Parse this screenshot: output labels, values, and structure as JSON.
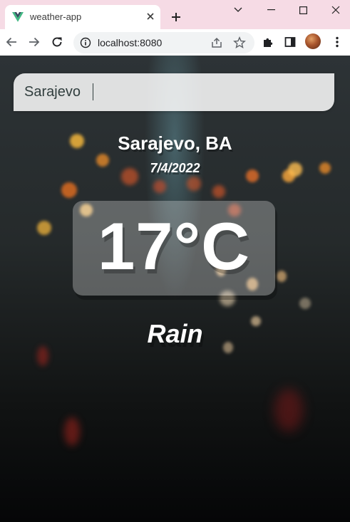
{
  "browser": {
    "tab": {
      "title": "weather-app",
      "favicon": "vue-logo-icon"
    },
    "url": "localhost:8080"
  },
  "app": {
    "search": {
      "value": "Sarajevo"
    },
    "location": "Sarajevo, BA",
    "date": "7/4/2022",
    "temperature": "17°C",
    "condition": "Rain"
  },
  "colors": {
    "tab_strip": "#f6dbe5",
    "text_primary": "#ffffff",
    "search_bg": "#dcdde0",
    "search_text": "#313e3e"
  }
}
